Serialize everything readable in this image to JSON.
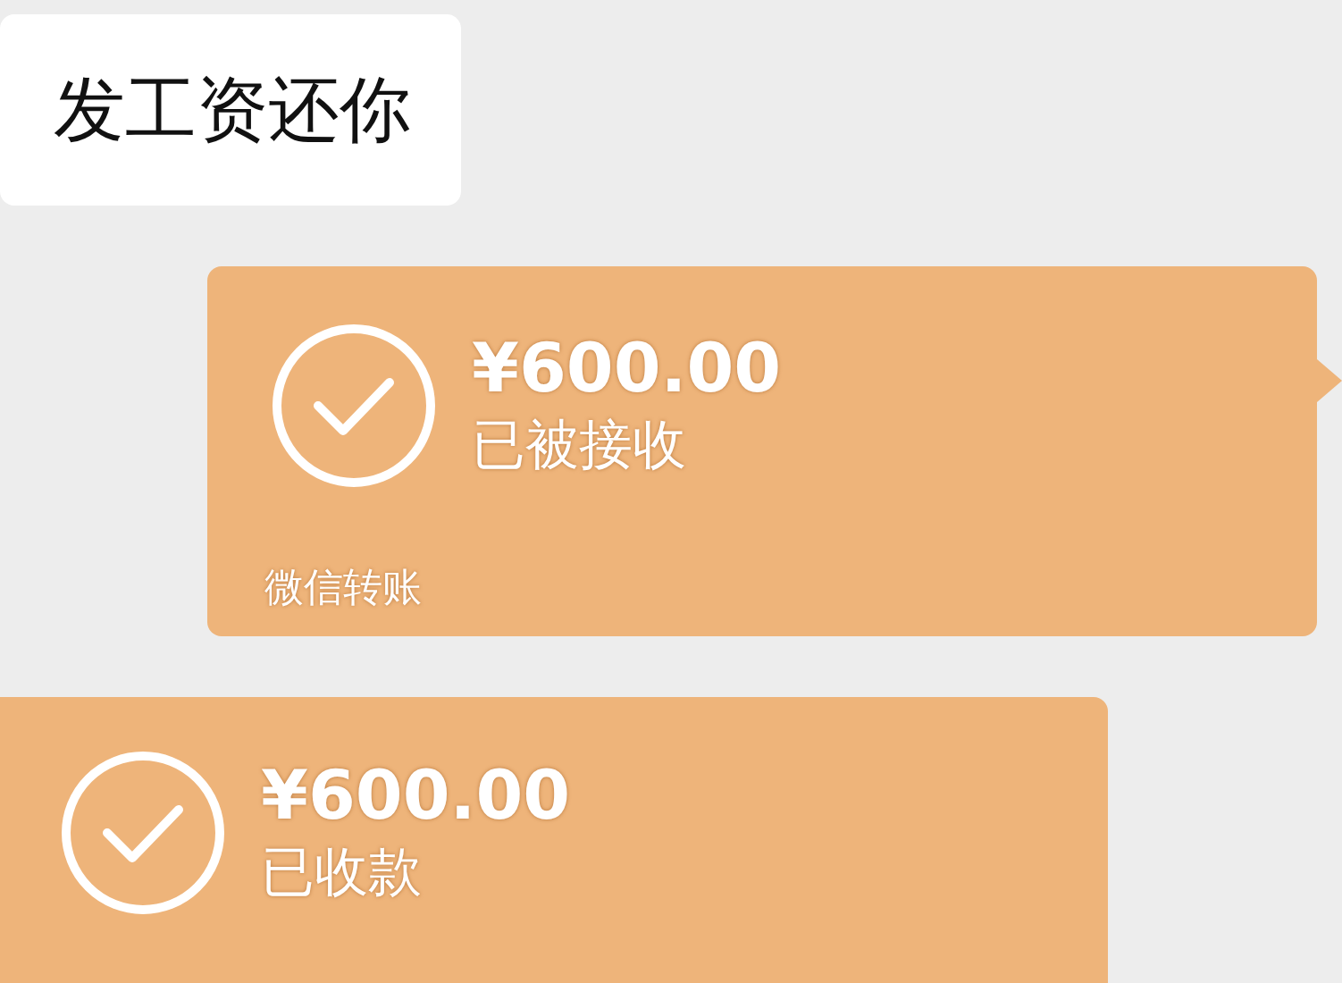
{
  "messages": [
    {
      "kind": "text",
      "outgoing": false,
      "text": "发工资还你"
    },
    {
      "kind": "transfer",
      "outgoing": true,
      "amount": "¥600.00",
      "status": "已被接收",
      "footer": "微信转账"
    },
    {
      "kind": "transfer",
      "outgoing": false,
      "amount": "¥600.00",
      "status": "已收款"
    }
  ]
}
